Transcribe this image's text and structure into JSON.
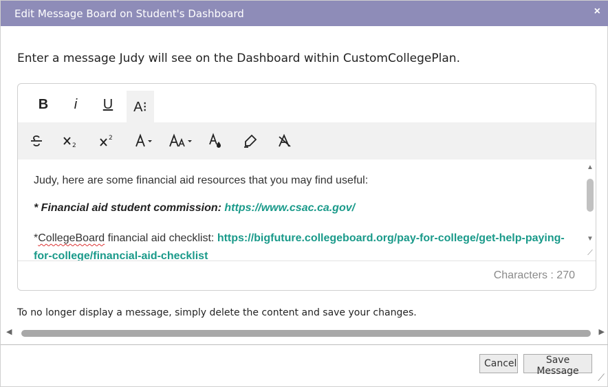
{
  "dialog": {
    "title": "Edit Message Board on Student's Dashboard",
    "close_glyph": "×",
    "intro": "Enter a message Judy will see on the Dashboard within CustomCollegePlan.",
    "note": "To no longer display a message, simply delete the content and save your changes."
  },
  "toolbar": {
    "row1": [
      {
        "label": "B"
      },
      {
        "label": "i"
      },
      {
        "label": "U"
      },
      {
        "label": "A⁝"
      }
    ],
    "row2_icons": [
      "strikethrough-icon",
      "subscript-icon",
      "superscript-icon",
      "font-color-icon",
      "font-size-icon",
      "text-color-drop-icon",
      "highlighter-icon",
      "clear-format-icon"
    ]
  },
  "content": {
    "line1": "Judy, here are some financial aid resources that you may find useful:",
    "line2_label": "* Financial aid student commission:",
    "line2_link": "https://www.csac.ca.gov/",
    "line3_prefix": "*",
    "line3_word": "CollegeBoard",
    "line3_text": " financial aid checklist:",
    "line3_link": "https://bigfuture.collegeboard.org/pay-for-college/get-help-paying-for-college/financial-aid-checklist"
  },
  "counter": "Characters : 270",
  "buttons": {
    "cancel": "Cancel",
    "save": "Save Message"
  },
  "colors": {
    "titlebar": "#8e8cb8",
    "link": "#1a9a8a"
  }
}
